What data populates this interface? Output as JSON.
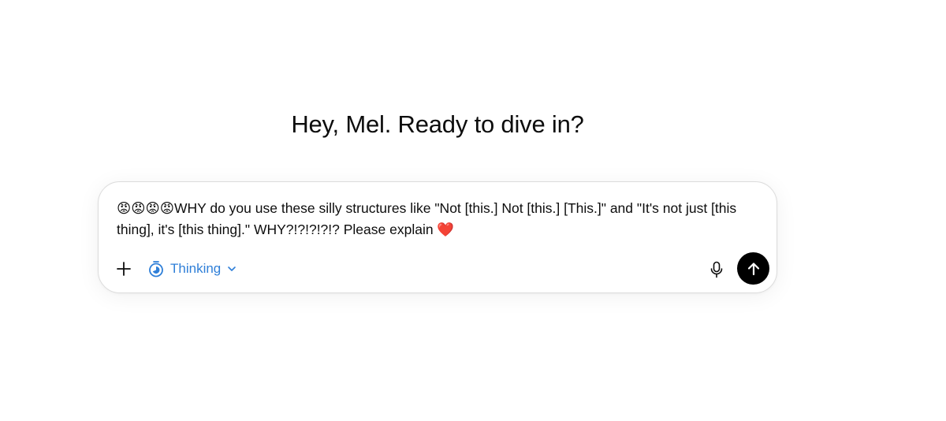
{
  "greeting": "Hey, Mel. Ready to dive in?",
  "composer": {
    "message": "😡😡😡😡WHY do you use these silly structures like \"Not [this.] Not [this.] [This.]\" and \"It's not just [this thing], it's [this thing].\" WHY?!?!?!?!? Please explain ❤️"
  },
  "toolbar": {
    "add_icon": "plus-icon",
    "thinking_label": "Thinking",
    "thinking_icon": "timer-icon",
    "dropdown_icon": "chevron-down-icon",
    "mic_icon": "microphone-icon",
    "send_icon": "arrow-up-icon"
  },
  "colors": {
    "accent": "#2f7fd8",
    "send_button": "#000000",
    "border": "#dcdcdc"
  }
}
